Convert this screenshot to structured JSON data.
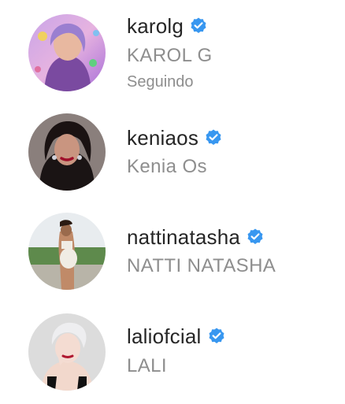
{
  "accounts": [
    {
      "username": "karolg",
      "full_name": "KAROL G",
      "status": "Seguindo",
      "verified": true
    },
    {
      "username": "keniaos",
      "full_name": "Kenia Os",
      "verified": true
    },
    {
      "username": "nattinatasha",
      "full_name": "NATTI NATASHA",
      "verified": true
    },
    {
      "username": "laliofcial",
      "full_name": "LALI",
      "verified": true
    }
  ],
  "colors": {
    "username": "#262626",
    "secondary_text": "#8e8e8e",
    "verified_badge": "#3897f0"
  },
  "icons": {
    "verified": "verified-badge-icon"
  }
}
